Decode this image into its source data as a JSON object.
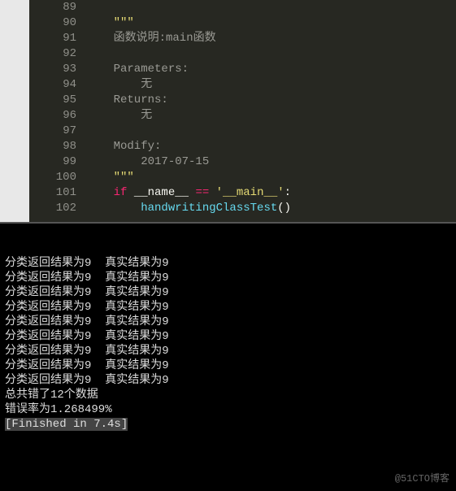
{
  "editor": {
    "lines": [
      {
        "num": 89,
        "segments": []
      },
      {
        "num": 90,
        "segments": [
          {
            "t": "    \"\"\"",
            "c": "string"
          }
        ]
      },
      {
        "num": 91,
        "segments": [
          {
            "t": "    函数说明:main函数",
            "c": "comment"
          }
        ]
      },
      {
        "num": 92,
        "segments": []
      },
      {
        "num": 93,
        "segments": [
          {
            "t": "    Parameters:",
            "c": "comment"
          }
        ]
      },
      {
        "num": 94,
        "segments": [
          {
            "t": "        无",
            "c": "comment"
          }
        ]
      },
      {
        "num": 95,
        "segments": [
          {
            "t": "    Returns:",
            "c": "comment"
          }
        ]
      },
      {
        "num": 96,
        "segments": [
          {
            "t": "        无",
            "c": "comment"
          }
        ]
      },
      {
        "num": 97,
        "segments": []
      },
      {
        "num": 98,
        "segments": [
          {
            "t": "    Modify:",
            "c": "comment"
          }
        ]
      },
      {
        "num": 99,
        "segments": [
          {
            "t": "        2017-07-15",
            "c": "comment"
          }
        ]
      },
      {
        "num": 100,
        "segments": [
          {
            "t": "    \"\"\"",
            "c": "string"
          }
        ]
      },
      {
        "num": 101,
        "segments": [
          {
            "t": "    ",
            "c": ""
          },
          {
            "t": "if",
            "c": "keyword"
          },
          {
            "t": " __name__ ",
            "c": "name"
          },
          {
            "t": "==",
            "c": "operator"
          },
          {
            "t": " ",
            "c": ""
          },
          {
            "t": "'__main__'",
            "c": "string"
          },
          {
            "t": ":",
            "c": "name"
          }
        ]
      },
      {
        "num": 102,
        "segments": [
          {
            "t": "        ",
            "c": ""
          },
          {
            "t": "handwritingClassTest",
            "c": "call"
          },
          {
            "t": "()",
            "c": "paren"
          }
        ]
      }
    ]
  },
  "terminal": {
    "lines": [
      {
        "t": "分类返回结果为9  真实结果为9",
        "hl": false
      },
      {
        "t": "分类返回结果为9  真实结果为9",
        "hl": false
      },
      {
        "t": "分类返回结果为9  真实结果为9",
        "hl": false
      },
      {
        "t": "分类返回结果为9  真实结果为9",
        "hl": false
      },
      {
        "t": "分类返回结果为9  真实结果为9",
        "hl": false
      },
      {
        "t": "分类返回结果为9  真实结果为9",
        "hl": false
      },
      {
        "t": "分类返回结果为9  真实结果为9",
        "hl": false
      },
      {
        "t": "分类返回结果为9  真实结果为9",
        "hl": false
      },
      {
        "t": "分类返回结果为9  真实结果为9",
        "hl": false
      },
      {
        "t": "总共错了12个数据",
        "hl": false
      },
      {
        "t": "错误率为1.268499%",
        "hl": false
      },
      {
        "t": "[Finished in 7.4s]",
        "hl": true
      }
    ]
  },
  "watermark": "@51CTO博客"
}
